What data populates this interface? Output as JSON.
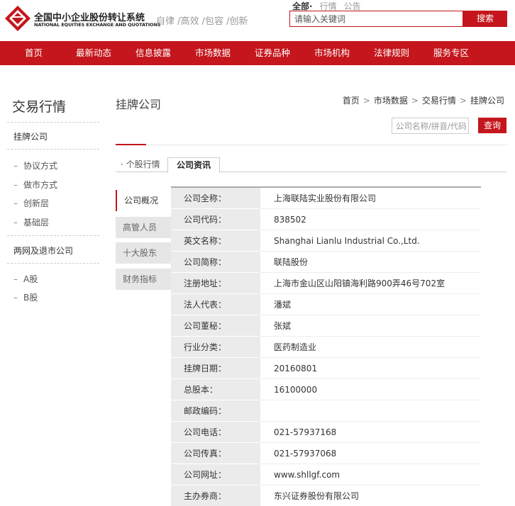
{
  "header": {
    "logo_cn": "全国中小企业股份转让系统",
    "logo_en": "NATIONAL EQUITIES EXCHANGE AND QUOTATIONS",
    "slogan": "自律 /高效 /包容 /创新",
    "search_tabs": [
      "全部·",
      "行情",
      "公告"
    ],
    "search_placeholder": "请输入关键词",
    "search_button": "搜索"
  },
  "nav": {
    "items": [
      "首页",
      "最新动态",
      "信息披露",
      "市场数据",
      "证券品种",
      "市场机构",
      "法律规则",
      "服务专区"
    ]
  },
  "sidebar": {
    "title": "交易行情",
    "section1": "挂牌公司",
    "items1": [
      "协议方式",
      "做市方式",
      "创新层",
      "基础层"
    ],
    "section2": "两网及退市公司",
    "items2": [
      "A股",
      "B股"
    ],
    "dash": "–"
  },
  "main": {
    "title": "挂牌公司",
    "breadcrumb": [
      "首页",
      "市场数据",
      "交易行情",
      "挂牌公司"
    ],
    "breadcrumb_sep": ">",
    "search_placeholder": "公司名称/拼音/代码",
    "query_button": "查询",
    "tabs": [
      "· 个股行情",
      "公司资讯"
    ],
    "subtabs": [
      "公司概况",
      "高管人员",
      "十大股东",
      "财务指标"
    ]
  },
  "company_info": [
    {
      "label": "公司全称：",
      "value": "上海联陆实业股份有限公司"
    },
    {
      "label": "公司代码：",
      "value": "838502"
    },
    {
      "label": "英文名称：",
      "value": "Shanghai Lianlu Industrial Co.,Ltd."
    },
    {
      "label": "公司简称：",
      "value": "联陆股份"
    },
    {
      "label": "注册地址：",
      "value": "上海市金山区山阳镇海利路900弄46号702室"
    },
    {
      "label": "法人代表：",
      "value": "潘斌"
    },
    {
      "label": "公司董秘：",
      "value": "张斌"
    },
    {
      "label": "行业分类：",
      "value": "医药制造业"
    },
    {
      "label": "挂牌日期：",
      "value": "20160801"
    },
    {
      "label": "总股本：",
      "value": "16100000"
    },
    {
      "label": "邮政编码：",
      "value": ""
    },
    {
      "label": "公司电话：",
      "value": "021-57937168"
    },
    {
      "label": "公司传真：",
      "value": "021-57937068"
    },
    {
      "label": "公司网址：",
      "value": "www.shllgf.com"
    },
    {
      "label": "主办券商：",
      "value": "东兴证券股份有限公司"
    }
  ],
  "colors": {
    "brand": "#c4161c"
  }
}
